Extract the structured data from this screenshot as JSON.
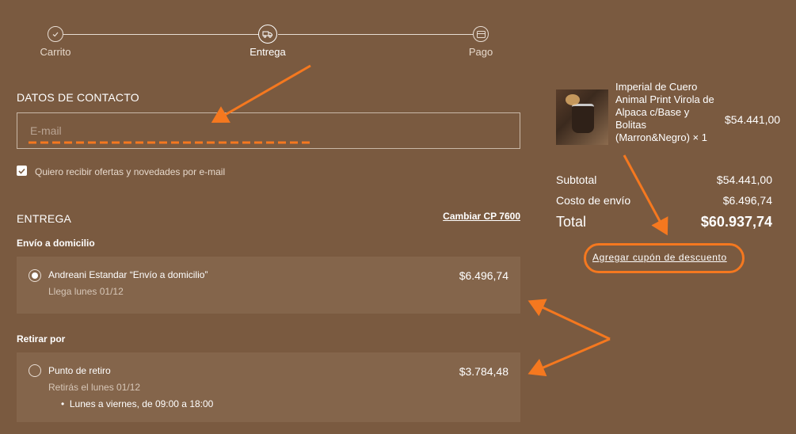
{
  "stepper": {
    "steps": [
      {
        "label": "Carrito",
        "icon": "check-icon",
        "state": "done"
      },
      {
        "label": "Entrega",
        "icon": "truck-icon",
        "state": "active"
      },
      {
        "label": "Pago",
        "icon": "card-icon",
        "state": "pending"
      }
    ]
  },
  "contact": {
    "title": "DATOS DE CONTACTO",
    "email_placeholder": "E-mail",
    "newsletter_label": "Quiero recibir ofertas y novedades por e-mail",
    "newsletter_checked": true
  },
  "delivery": {
    "title": "ENTREGA",
    "change_cp_label": "Cambiar CP 7600",
    "home_group_label": "Envío a domicilio",
    "home_option": {
      "title": "Andreani Estandar “Envío a domicilio”",
      "subtitle": "Llega lunes 01/12",
      "price": "$6.496,74",
      "selected": true
    },
    "pickup_group_label": "Retirar por",
    "pickup_option": {
      "title": "Punto de retiro",
      "subtitle": "Retirás el lunes 01/12",
      "hours": "Lunes a viernes, de 09:00 a 18:00",
      "price": "$3.784,48",
      "selected": false
    }
  },
  "summary": {
    "product": {
      "name": "Imperial de Cuero Animal Print Virola de Alpaca c/Base y Bolitas (Marron&Negro) × 1",
      "price": "$54.441,00"
    },
    "subtotal_label": "Subtotal",
    "subtotal_value": "$54.441,00",
    "shipping_label": "Costo de envío",
    "shipping_value": "$6.496,74",
    "total_label": "Total",
    "total_value": "$60.937,74",
    "coupon_label": "Agregar cupón de descuento"
  },
  "colors": {
    "background": "#7a5a40",
    "card": "#84654b",
    "annotation": "#f5781f"
  }
}
